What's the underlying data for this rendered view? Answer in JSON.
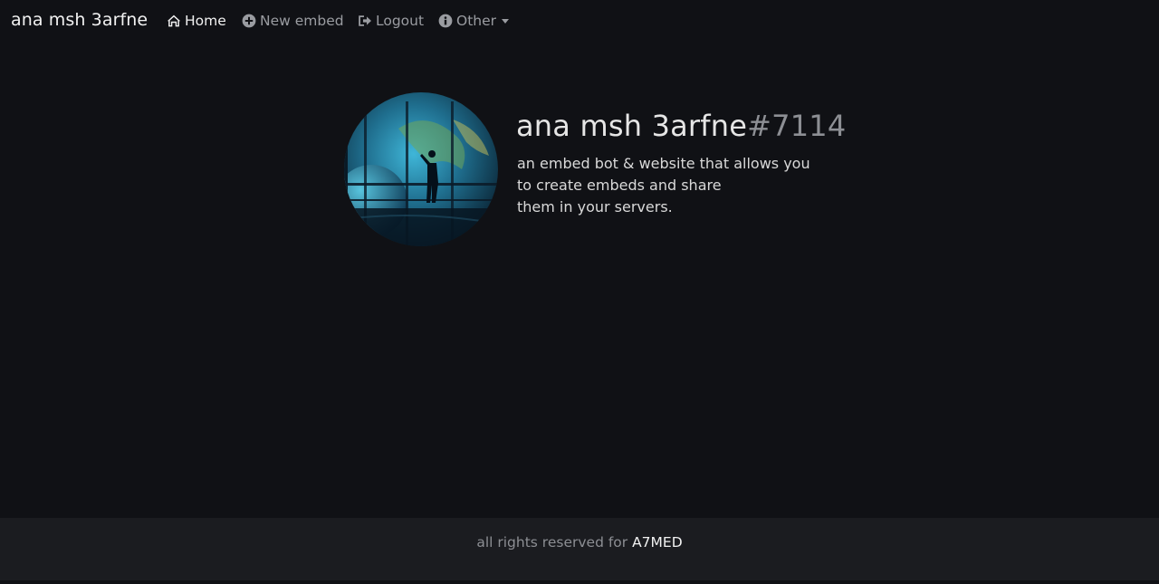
{
  "navbar": {
    "brand": "ana msh 3arfne",
    "items": [
      {
        "label": "Home",
        "icon": "home-icon",
        "active": true
      },
      {
        "label": "New embed",
        "icon": "plus-circle-icon",
        "active": false
      },
      {
        "label": "Logout",
        "icon": "logout-icon",
        "active": false
      },
      {
        "label": "Other",
        "icon": "info-circle-icon",
        "active": false,
        "dropdown": true
      }
    ]
  },
  "profile": {
    "avatar_icon": "avatar-image",
    "name": "ana msh 3arfne",
    "discriminator": "#7114",
    "bio_lines": [
      "an embed bot & website that allows you",
      "to create embeds and share",
      "them in your servers."
    ]
  },
  "footer": {
    "prefix": "all rights reserved for ",
    "author": "A7MED"
  },
  "colors": {
    "background": "#101115",
    "footer_background": "#1b1c20",
    "text_primary": "#f2f2f2",
    "text_muted": "#9a9ca1"
  }
}
